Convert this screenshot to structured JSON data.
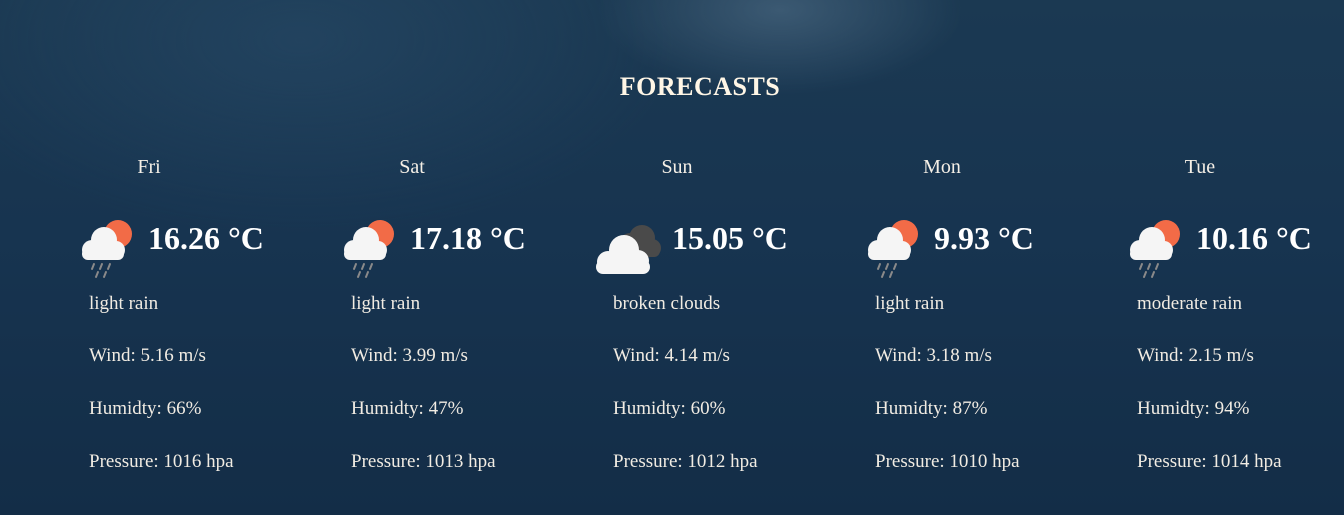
{
  "title": "FORECASTS",
  "colors": {
    "background": "#173450",
    "text": "#f2f2f2",
    "sun": "#f26b47",
    "cloud": "#f5f5f5",
    "dark_cloud": "#4a4a4a",
    "rain": "#8a8a8a"
  },
  "forecasts": [
    {
      "day": "Fri",
      "temp": "16.26 °C",
      "description": "light rain",
      "icon": "rain-sun-icon",
      "wind": "Wind: 5.16 m/s",
      "humidity": "Humidty: 66%",
      "pressure": "Pressure: 1016 hpa"
    },
    {
      "day": "Sat",
      "temp": "17.18 °C",
      "description": "light rain",
      "icon": "rain-sun-icon",
      "wind": "Wind: 3.99 m/s",
      "humidity": "Humidty: 47%",
      "pressure": "Pressure: 1013 hpa"
    },
    {
      "day": "Sun",
      "temp": "15.05 °C",
      "description": "broken clouds",
      "icon": "broken-clouds-icon",
      "wind": "Wind: 4.14 m/s",
      "humidity": "Humidty: 60%",
      "pressure": "Pressure: 1012 hpa"
    },
    {
      "day": "Mon",
      "temp": "9.93 °C",
      "description": "light rain",
      "icon": "rain-sun-icon",
      "wind": "Wind: 3.18 m/s",
      "humidity": "Humidty: 87%",
      "pressure": "Pressure: 1010 hpa"
    },
    {
      "day": "Tue",
      "temp": "10.16 °C",
      "description": "moderate rain",
      "icon": "rain-sun-icon",
      "wind": "Wind: 2.15 m/s",
      "humidity": "Humidty: 94%",
      "pressure": "Pressure: 1014 hpa"
    }
  ]
}
